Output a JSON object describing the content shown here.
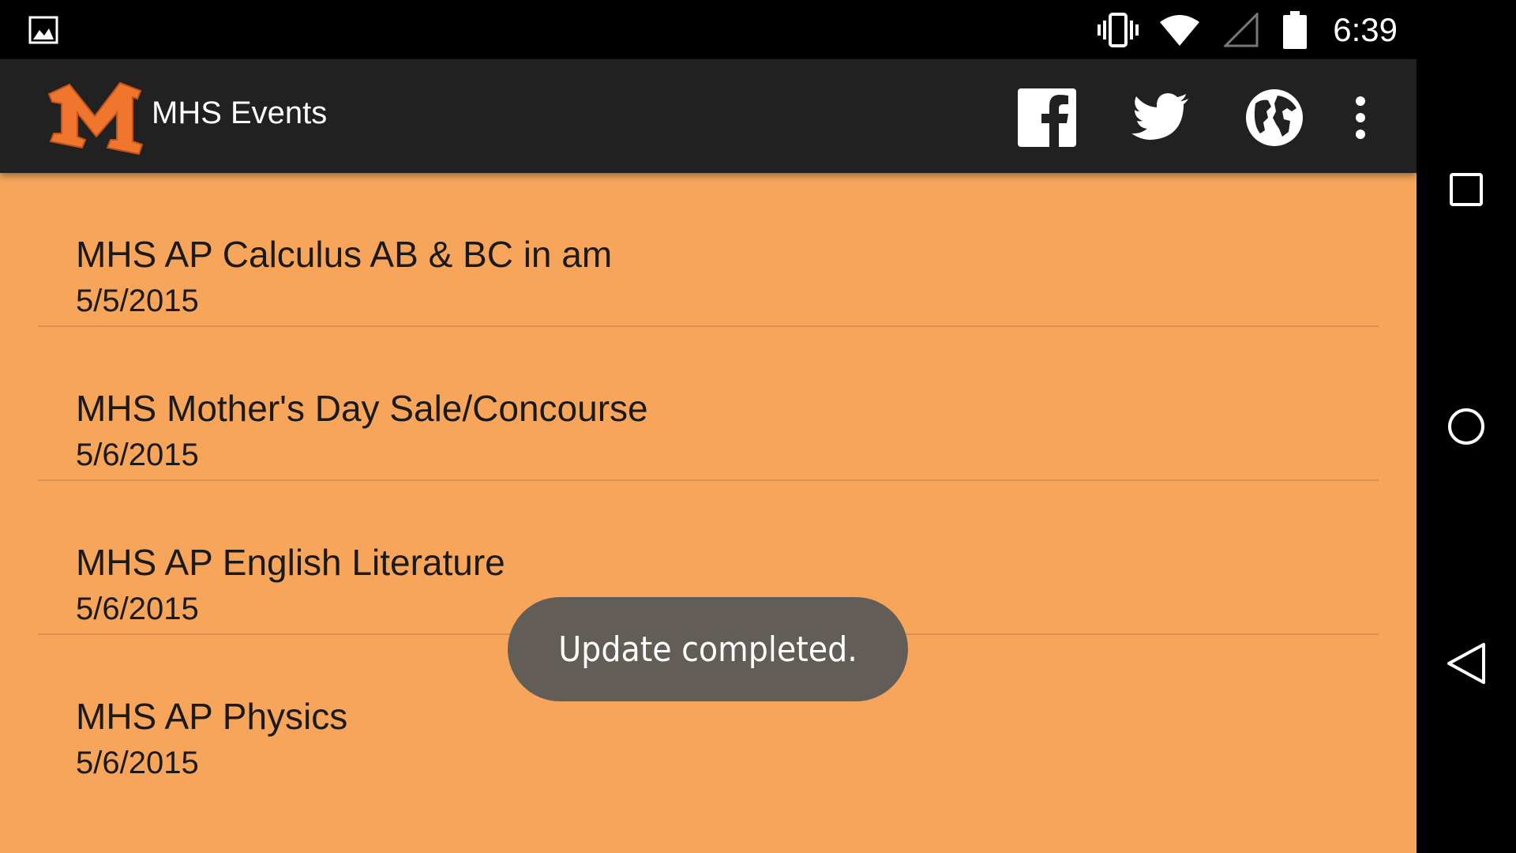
{
  "status_bar": {
    "time": "6:39",
    "icons": [
      "image-notification-icon",
      "vibrate-icon",
      "wifi-icon",
      "cell-signal-icon",
      "battery-icon"
    ]
  },
  "app_bar": {
    "title": "MHS Events",
    "logo_icon": "mhs-m-logo",
    "actions": [
      "facebook-icon",
      "twitter-icon",
      "globe-icon",
      "overflow-menu-icon"
    ]
  },
  "events": [
    {
      "title": "MHS AP Calculus AB & BC in am",
      "date": "5/5/2015"
    },
    {
      "title": "MHS Mother's Day Sale/Concourse",
      "date": "5/6/2015"
    },
    {
      "title": "MHS AP English Literature",
      "date": "5/6/2015"
    },
    {
      "title": "MHS AP Physics",
      "date": "5/6/2015"
    }
  ],
  "toast": {
    "message": "Update completed."
  },
  "nav_bar": [
    "recents-icon",
    "home-icon",
    "back-icon"
  ],
  "colors": {
    "app_bar": "#212121",
    "content_bg": "#F7A55A",
    "logo_orange": "#F0762E",
    "toast_bg": "#635d58"
  }
}
